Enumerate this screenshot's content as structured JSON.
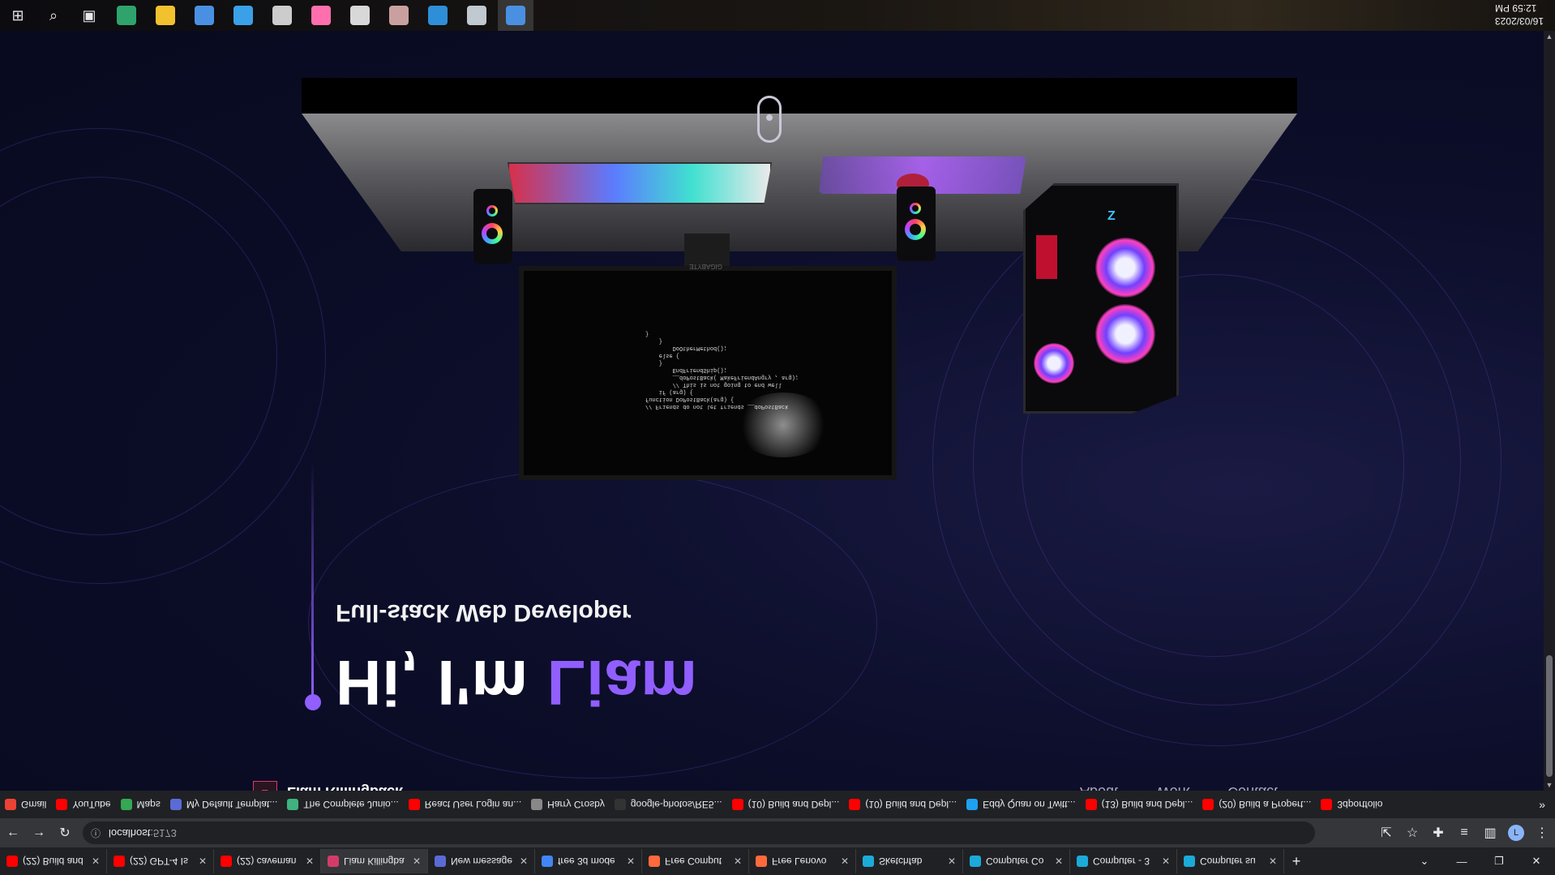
{
  "taskbar": {
    "clock": {
      "date": "16/03/2023",
      "time": "12:59 PM"
    },
    "apps": [
      {
        "name": "edge-icon",
        "color": "#2fa36b"
      },
      {
        "name": "file-explorer-icon",
        "color": "#f2c12e"
      },
      {
        "name": "store-icon",
        "color": "#4a90e2"
      },
      {
        "name": "mail-icon",
        "color": "#3aa0e8"
      },
      {
        "name": "m-app-icon",
        "color": "#cccccc"
      },
      {
        "name": "pink-app-icon",
        "color": "#ff6fae"
      },
      {
        "name": "word-icon",
        "color": "#d8d8d8"
      },
      {
        "name": "photo-app-icon",
        "color": "#c9a0a0"
      },
      {
        "name": "vscode-icon",
        "color": "#2f8ed8"
      },
      {
        "name": "steam-icon",
        "color": "#c0c8d0"
      },
      {
        "name": "chrome-icon",
        "color": "#4a90e2"
      }
    ]
  },
  "hero": {
    "greeting": "Hi, I'm ",
    "name": "Liam",
    "subtitle": "Full-stack Web Developer",
    "accent": "#915eff"
  },
  "nav": {
    "logo_letter": "L",
    "brand": "Liam Killingback",
    "links": [
      "About",
      "Work",
      "Contact"
    ]
  },
  "monitor": {
    "brand": "GIGABYTE",
    "code": "// Friends do not let friends __doPostBack\nfunction DoPostBack(arg) {\n    if (arg) {\n        // This is not going to end well\n        __doPostBack( MakeFriendAngry , arg);\n        EndFriendShip();\n    }\n    else {\n        DoOtherMethod();\n    }\n}"
  },
  "bookmarks": [
    {
      "label": "Gmail",
      "color": "#ea4335"
    },
    {
      "label": "YouTube",
      "color": "#ff0000"
    },
    {
      "label": "Maps",
      "color": "#34a853"
    },
    {
      "label": "My Default Templat...",
      "color": "#5b6bd6"
    },
    {
      "label": "The Complete Junio...",
      "color": "#3fb27f"
    },
    {
      "label": "React User Login an...",
      "color": "#ff0000"
    },
    {
      "label": "Harry Crosby",
      "color": "#888888"
    },
    {
      "label": "google-photos/RE5...",
      "color": "#333333"
    },
    {
      "label": "(10) Build and Depl...",
      "color": "#ff0000"
    },
    {
      "label": "(10) Build and Depl...",
      "color": "#ff0000"
    },
    {
      "label": "Eddy Quan on Twitt...",
      "color": "#1da1f2"
    },
    {
      "label": "(13) Build and Depl...",
      "color": "#ff0000"
    },
    {
      "label": "(20) Build a Propert...",
      "color": "#ff0000"
    },
    {
      "label": "3dportfolio",
      "color": "#ff0000"
    }
  ],
  "bookmarks_more": "»",
  "toolbar": {
    "url_host": "localhost",
    "url_port": ":5173"
  },
  "tabs": [
    {
      "label": "(22) Build and",
      "color": "#ff0000",
      "active": false
    },
    {
      "label": "(22) GPT-4 Is",
      "color": "#ff0000",
      "active": false
    },
    {
      "label": "(22) caveman",
      "color": "#ff0000",
      "active": false
    },
    {
      "label": "Liam Killingba",
      "color": "#d33c6a",
      "active": true
    },
    {
      "label": "New message",
      "color": "#5b6bd6",
      "active": false
    },
    {
      "label": "free 3d mode",
      "color": "#4285f4",
      "active": false
    },
    {
      "label": "Free Comput",
      "color": "#ff6a3d",
      "active": false
    },
    {
      "label": "Free Lenovo",
      "color": "#ff6a3d",
      "active": false
    },
    {
      "label": "Sketchfab",
      "color": "#1caad9",
      "active": false
    },
    {
      "label": "Computer Co",
      "color": "#1caad9",
      "active": false
    },
    {
      "label": "Computer - 3",
      "color": "#1caad9",
      "active": false
    },
    {
      "label": "Computer su",
      "color": "#1caad9",
      "active": false
    }
  ]
}
